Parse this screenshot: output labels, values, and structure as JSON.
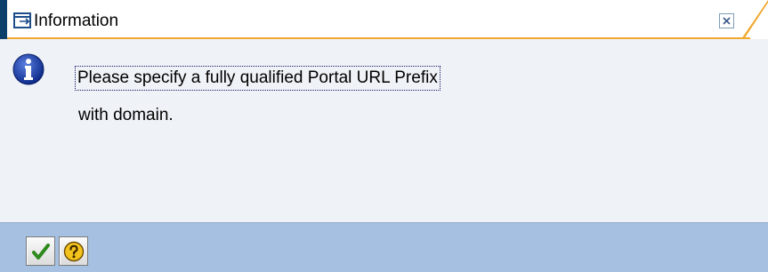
{
  "dialog": {
    "title": "Information",
    "message_line1": "Please specify a fully qualified Portal URL Prefix",
    "message_line2": "with domain."
  },
  "icons": {
    "title": "window-icon",
    "message": "info-icon",
    "close": "close-icon",
    "ok": "checkmark-icon",
    "help": "help-icon"
  },
  "colors": {
    "title_accent": "#0c3f6a",
    "title_underline": "#f0a830",
    "footer": "#a5c0e1",
    "info_blue": "#1e3fa8"
  }
}
